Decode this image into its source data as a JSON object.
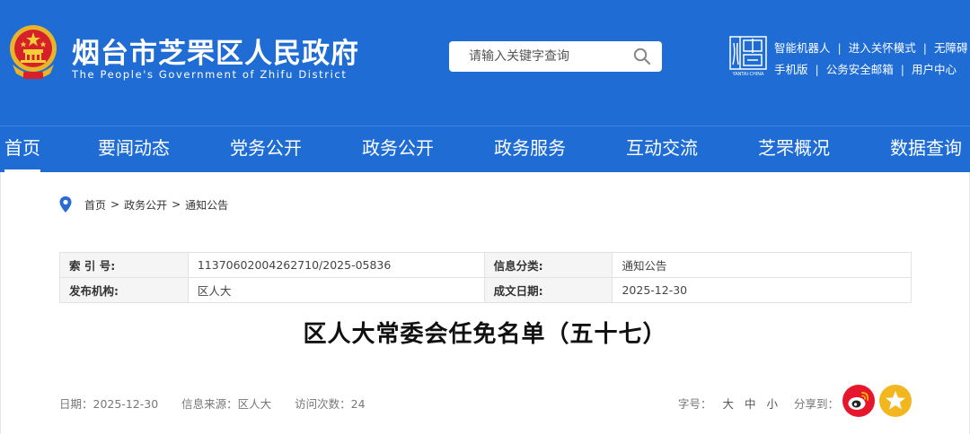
{
  "header": {
    "title": "烟台市芝罘区人民政府",
    "subtitle": "The People's Government of Zhifu District",
    "search_placeholder": "请输入关键字查询",
    "city_logo_caption": "YANTAI·CHINA",
    "links_row1": [
      "智能机器人",
      "进入关怀模式",
      "无障碍"
    ],
    "links_row2": [
      "手机版",
      "公务安全邮箱",
      "用户中心"
    ],
    "link_separator": "|",
    "brand_color": "#1f6cd5"
  },
  "nav": {
    "items": [
      "首页",
      "要闻动态",
      "党务公开",
      "政务公开",
      "政务服务",
      "互动交流",
      "芝罘概况",
      "数据查询"
    ],
    "active": "首页"
  },
  "breadcrumb": {
    "items": [
      "首页",
      "政务公开",
      "通知公告"
    ],
    "separator": ">"
  },
  "meta": {
    "index_label": "索 引 号:",
    "index_value": "11370602004262710/2025-05836",
    "category_label": "信息分类:",
    "category_value": "通知公告",
    "publisher_label": "发布机构:",
    "publisher_value": "区人大",
    "date_label": "成文日期:",
    "date_value": "2025-12-30"
  },
  "article": {
    "title": "区人大常委会任免名单（五十七）",
    "date_text": "日期：2025-12-30",
    "source_text": "信息来源：区人大",
    "visits_text": "访问次数：24"
  },
  "tools": {
    "font_size_label": "字号：",
    "sizes": [
      "大",
      "中",
      "小"
    ],
    "share_label": "分享到：",
    "icons": [
      "weibo-icon",
      "favorite-star-icon"
    ]
  }
}
